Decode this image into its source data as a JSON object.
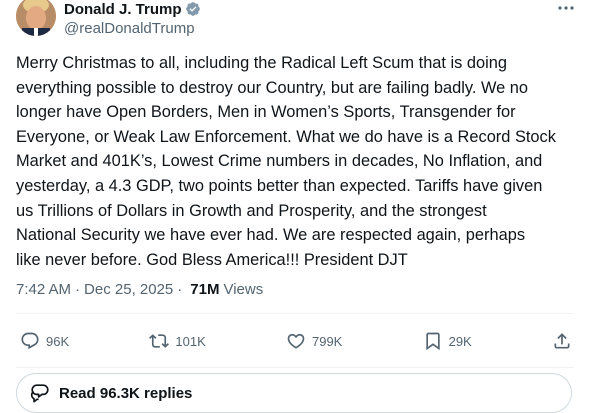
{
  "author": {
    "display_name": "Donald J. Trump",
    "handle": "@realDonaldTrump",
    "verified_color": "#829aab",
    "avatar_icon": "avatar-photo"
  },
  "tweet": {
    "text": "Merry Christmas to all, including the Radical Left Scum that is doing\neverything possible to destroy our Country, but are failing badly. We no\nlonger have Open Borders, Men in Women’s Sports, Transgender for\nEveryone, or Weak Law Enforcement. What we do have is a Record Stock\nMarket and 401K’s, Lowest Crime numbers in decades, No Inflation, and\nyesterday, a 4.3 GDP, two points better than expected. Tariffs have given\nus Trillions of Dollars in Growth and Prosperity, and the strongest\nNational Security we have ever had. We are respected again, perhaps\nlike never before. God Bless America!!! President DJT"
  },
  "meta": {
    "time": "7:42 AM",
    "separator": "·",
    "date": "Dec 25, 2025",
    "views_count": "71M",
    "views_label": "Views"
  },
  "actions": {
    "reply": {
      "icon": "reply-icon",
      "count": "96K"
    },
    "retweet": {
      "icon": "retweet-icon",
      "count": "101K"
    },
    "like": {
      "icon": "heart-icon",
      "count": "799K"
    },
    "bookmark": {
      "icon": "bookmark-icon",
      "count": "29K"
    },
    "share": {
      "icon": "share-icon"
    }
  },
  "replies_button": {
    "label": "Read 96.3K replies",
    "icon": "speech-bubbles-icon"
  },
  "colors": {
    "text_primary": "#0f1419",
    "text_secondary": "#536471",
    "border": "#cfd9de"
  }
}
